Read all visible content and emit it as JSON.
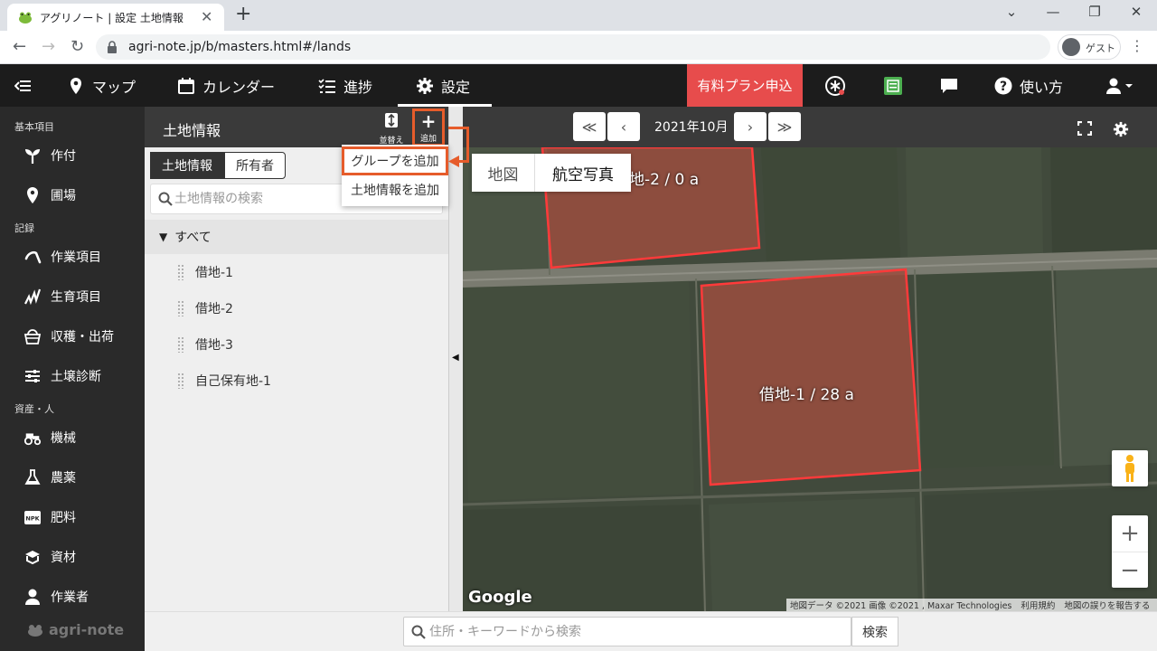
{
  "browser": {
    "tab_title": "アグリノート | 設定 土地情報",
    "tab_close": "✕",
    "new_tab": "+",
    "url": "agri-note.jp/b/masters.html#/lands",
    "profile_label": "ゲスト"
  },
  "nav": {
    "map": "マップ",
    "calendar": "カレンダー",
    "progress": "進捗",
    "settings": "設定",
    "paid_plan": "有料プラン申込",
    "help": "使い方"
  },
  "sidebar": {
    "section_basic": "基本項目",
    "crops": "作付",
    "fields": "圃場",
    "section_records": "記録",
    "work_items": "作業項目",
    "growth_items": "生育項目",
    "harvest": "収穫・出荷",
    "soil": "土壌診断",
    "section_assets": "資産・人",
    "machines": "機械",
    "pesticides": "農薬",
    "fertilizer": "肥料",
    "materials": "資材",
    "workers": "作業者",
    "logo": "agri-note"
  },
  "panel": {
    "title": "土地情報",
    "sort_label": "並替え",
    "add_label": "追加",
    "add_plus": "+",
    "tab_land": "土地情報",
    "tab_owner": "所有者",
    "search_placeholder": "土地情報の検索",
    "group_all": "すべて",
    "group_arrow": "▼",
    "lands": [
      "借地-1",
      "借地-2",
      "借地-3",
      "自己保有地-1"
    ]
  },
  "add_menu": {
    "add_group": "グループを追加",
    "add_land": "土地情報を追加"
  },
  "map": {
    "month": "2021年10月",
    "type_map": "地図",
    "type_satellite": "航空写真",
    "field1_label": "借地-1 / 28 a",
    "field2_label": "地-2 / 0 a",
    "google": "Google",
    "attribution_data": "地図データ ©2021 画像 ©2021 , Maxar Technologies",
    "attribution_terms": "利用規約",
    "attribution_report": "地図の誤りを報告する",
    "zoom_in": "+",
    "zoom_out": "−",
    "nav_first": "≪",
    "nav_prev": "‹",
    "nav_next": "›",
    "nav_last": "≫"
  },
  "bottom": {
    "search_placeholder": "住所・キーワードから検索",
    "search_button": "検索"
  },
  "colors": {
    "accent_red": "#e74c4c",
    "callout_orange": "#e65c2b",
    "dark_bg": "#1c1c1c"
  }
}
